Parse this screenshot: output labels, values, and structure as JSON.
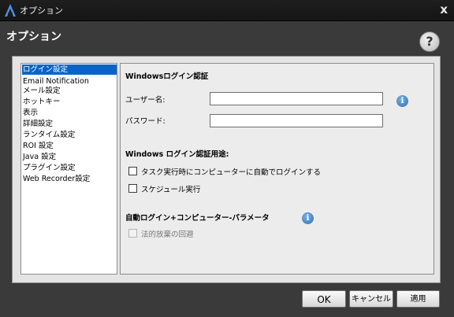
{
  "window": {
    "title": "オプション",
    "close_glyph": "x"
  },
  "header": {
    "heading": "オプション",
    "help_glyph": "?"
  },
  "sidebar": {
    "items": [
      {
        "label": "ログイン設定",
        "selected": true
      },
      {
        "label": "Email Notification",
        "selected": false
      },
      {
        "label": "メール設定",
        "selected": false
      },
      {
        "label": "ホットキー",
        "selected": false
      },
      {
        "label": "表示",
        "selected": false
      },
      {
        "label": "詳細設定",
        "selected": false
      },
      {
        "label": "ランタイム設定",
        "selected": false
      },
      {
        "label": "ROI 設定",
        "selected": false
      },
      {
        "label": "Java 設定",
        "selected": false
      },
      {
        "label": "プラグイン設定",
        "selected": false
      },
      {
        "label": "Web Recorder設定",
        "selected": false
      }
    ]
  },
  "panel": {
    "windows_login_title": "Windowsログイン認証",
    "username_label": "ユーザー名:",
    "username_value": "",
    "password_label": "パスワード:",
    "password_value": "",
    "usage_title": "Windows ログイン認証用途:",
    "checkbox_auto_login": {
      "label": "タスク実行時にコンピューターに自動でログインする",
      "checked": false
    },
    "checkbox_schedule": {
      "label": "スケジュール実行",
      "checked": false
    },
    "auto_login_params_title": "自動ログイン+コンピューター-パラメータ",
    "checkbox_legal": {
      "label": "法的放棄の回避",
      "checked": false,
      "disabled": true
    },
    "info_glyph": "i"
  },
  "footer": {
    "ok_label": "OK",
    "cancel_label": "キャンセル",
    "apply_label": "適用"
  },
  "colors": {
    "selection": "#0a64c8",
    "background": "#3a3a3a",
    "panel": "#ececec",
    "info": "#2e6fb0"
  }
}
